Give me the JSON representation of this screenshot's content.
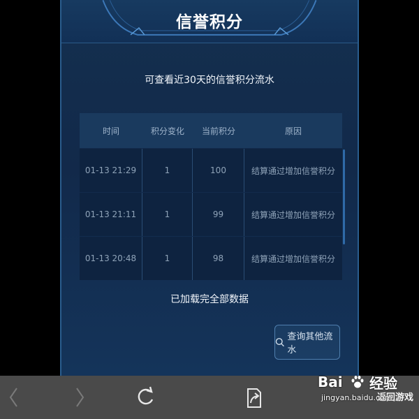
{
  "header": {
    "title": "信誉积分"
  },
  "subtitle": "可查看近30天的信誉积分流水",
  "table": {
    "columns": [
      "时间",
      "积分变化",
      "当前积分",
      "原因"
    ],
    "rows": [
      {
        "time": "01-13  21:29",
        "change": "1",
        "current": "100",
        "reason": "结算通过增加信誉积分"
      },
      {
        "time": "01-13  21:11",
        "change": "1",
        "current": "99",
        "reason": "结算通过增加信誉积分"
      },
      {
        "time": "01-13  20:48",
        "change": "1",
        "current": "98",
        "reason": "结算通过增加信誉积分"
      }
    ]
  },
  "status": {
    "loaded_text": "已加载完全部数据"
  },
  "query_button": {
    "label": "查询其他流水",
    "icon": "search-icon"
  },
  "bottom_bar": {
    "back_game_label": "返回游戏"
  },
  "watermark": {
    "brand": "Bai",
    "experience": "经验",
    "url": "jingyan.baidu.com"
  },
  "colors": {
    "panel": "#12294a",
    "header": "#173a60",
    "table_header": "#1a3a5e",
    "bottom_bar": "#4a4a4a"
  }
}
